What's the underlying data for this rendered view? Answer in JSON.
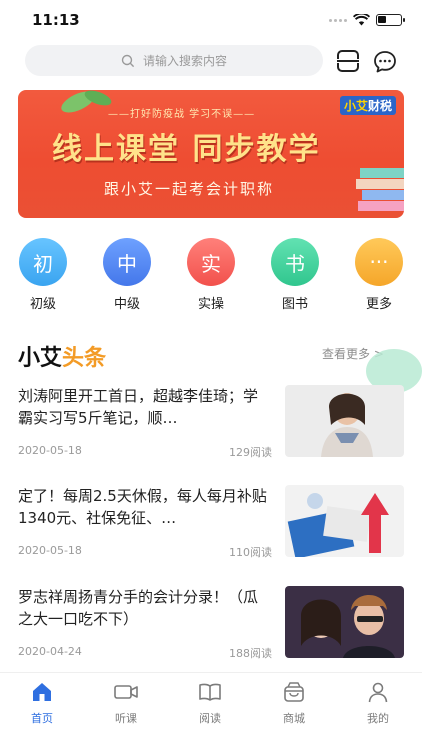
{
  "status": {
    "time": "11:13"
  },
  "search": {
    "placeholder": "请输入搜索内容"
  },
  "banner": {
    "slogan": "——打好防疫战 学习不误——",
    "headline": "线上课堂 同步教学",
    "subline": "跟小艾一起考会计职称",
    "brand_a": "小艾",
    "brand_b": "财税"
  },
  "categories": [
    {
      "glyph": "初",
      "label": "初级",
      "color": "#4aaef3"
    },
    {
      "glyph": "中",
      "label": "中级",
      "color": "#4c83ef"
    },
    {
      "glyph": "实",
      "label": "实操",
      "color": "#f7605b"
    },
    {
      "glyph": "书",
      "label": "图书",
      "color": "#43d39f"
    },
    {
      "glyph": "···",
      "label": "更多",
      "color": "#f8b43a"
    }
  ],
  "section": {
    "title_main": "小艾",
    "title_accent": "头条",
    "more": "查看更多 >"
  },
  "news": [
    {
      "title": "刘涛阿里开工首日，超越李佳琦；学霸实习写5斤笔记，顺…",
      "date": "2020-05-18",
      "reads": "129阅读"
    },
    {
      "title": "定了！每周2.5天休假，每人每月补贴1340元、社保免征、…",
      "date": "2020-05-18",
      "reads": "110阅读"
    },
    {
      "title": "罗志祥周扬青分手的会计分录！（瓜之大一口吃不下）",
      "date": "2020-04-24",
      "reads": "188阅读"
    }
  ],
  "tabs": [
    {
      "label": "首页",
      "icon": "home-icon",
      "active": true
    },
    {
      "label": "听课",
      "icon": "video-icon",
      "active": false
    },
    {
      "label": "阅读",
      "icon": "book-icon",
      "active": false
    },
    {
      "label": "商城",
      "icon": "shop-icon",
      "active": false
    },
    {
      "label": "我的",
      "icon": "user-icon",
      "active": false
    }
  ],
  "colors": {
    "accent": "#f39b26",
    "active_tab": "#2f6fe0"
  }
}
